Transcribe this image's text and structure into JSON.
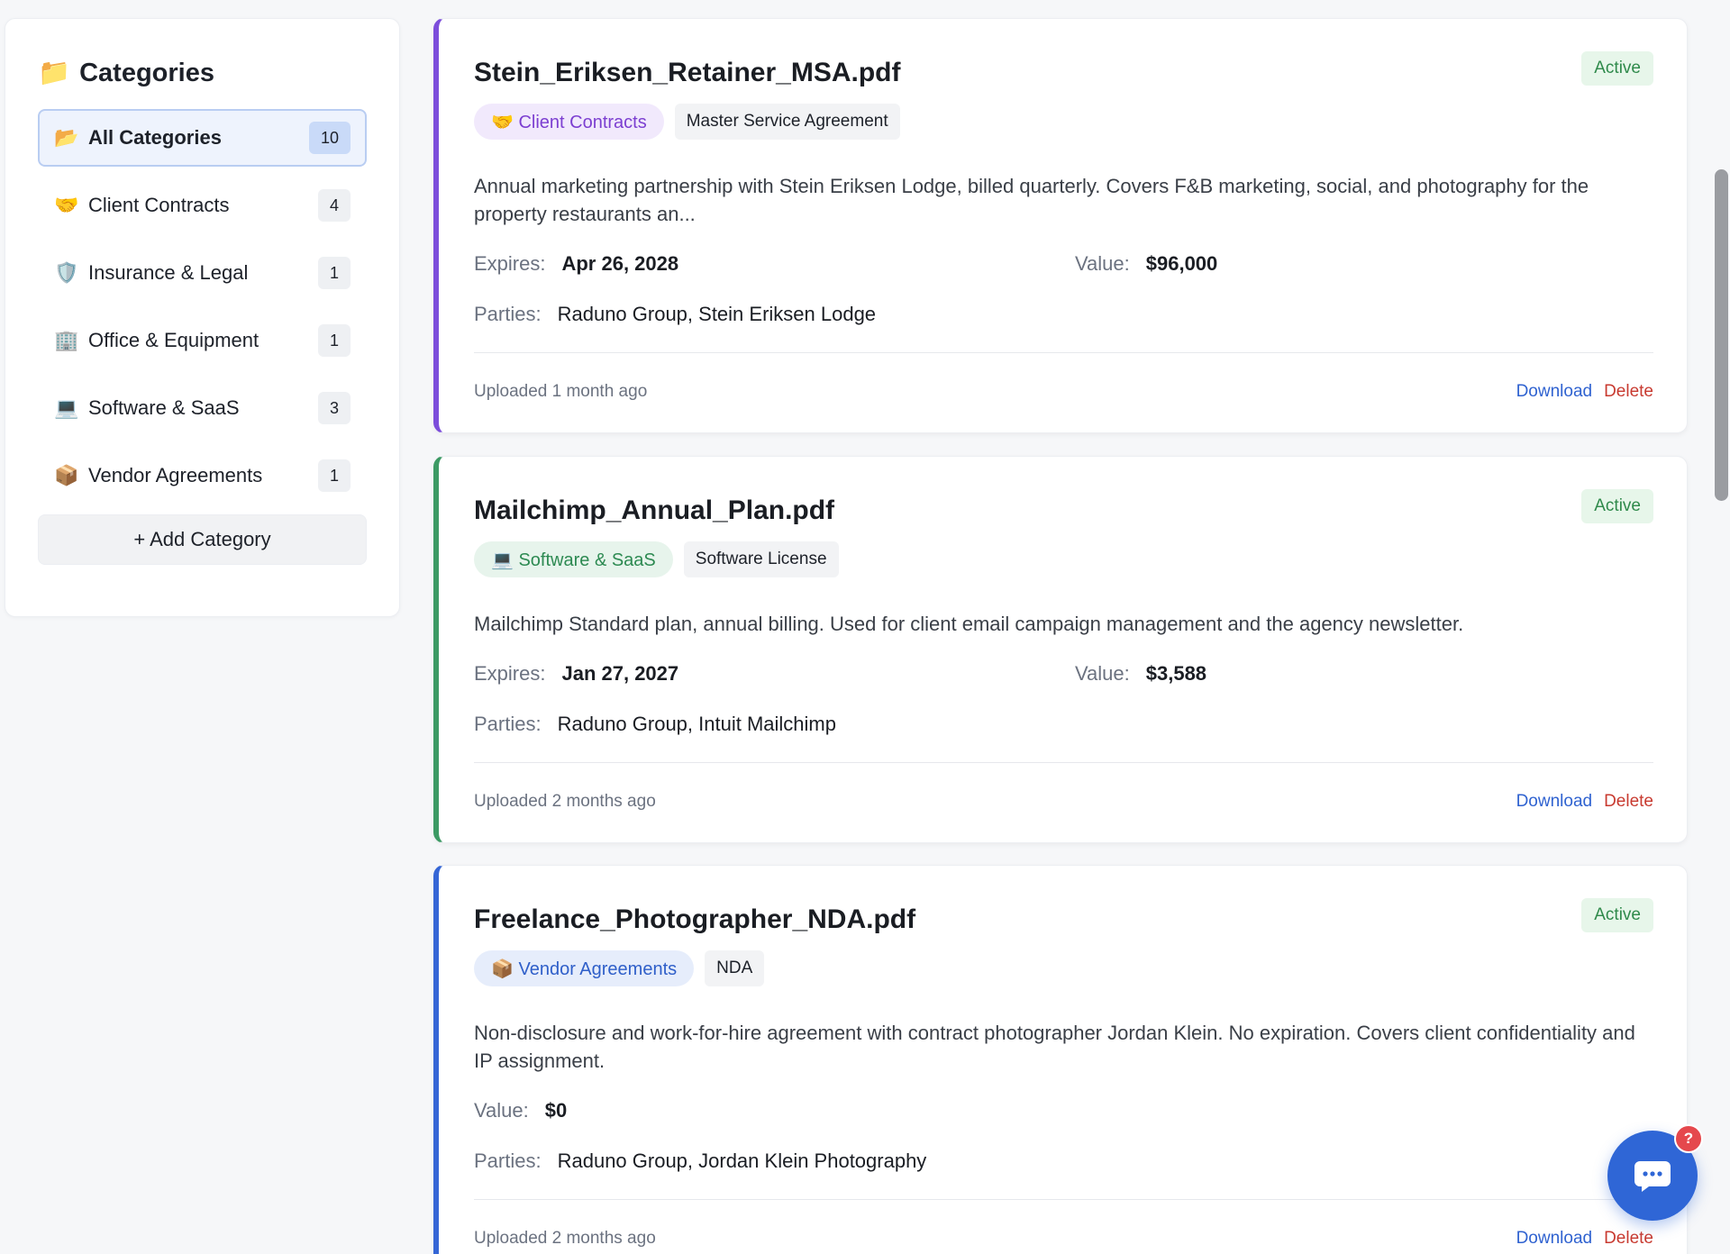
{
  "sidebar": {
    "title_icon": "📁",
    "title": "Categories",
    "items": [
      {
        "emoji": "📂",
        "label": "All Categories",
        "count": "10",
        "active": true
      },
      {
        "emoji": "🤝",
        "label": "Client Contracts",
        "count": "4"
      },
      {
        "emoji": "🛡️",
        "label": "Insurance & Legal",
        "count": "1"
      },
      {
        "emoji": "🏢",
        "label": "Office & Equipment",
        "count": "1"
      },
      {
        "emoji": "💻",
        "label": "Software & SaaS",
        "count": "3"
      },
      {
        "emoji": "📦",
        "label": "Vendor Agreements",
        "count": "1"
      }
    ],
    "add_label": "+ Add Category"
  },
  "cards": [
    {
      "filename": "Stein_Eriksen_Retainer_MSA.pdf",
      "status": "Active",
      "category": "🤝 Client Contracts",
      "type": "Master Service Agreement",
      "description": "Annual marketing partnership with Stein Eriksen Lodge, billed quarterly. Covers F&B marketing, social, and photography for the property restaurants an...",
      "expires_label": "Expires:",
      "expires": "Apr 26, 2028",
      "value_label": "Value:",
      "value": "$96,000",
      "parties_label": "Parties:",
      "parties": "Raduno Group, Stein Eriksen Lodge",
      "uploaded": "Uploaded 1 month ago",
      "download": "Download",
      "delete": "Delete"
    },
    {
      "filename": "Mailchimp_Annual_Plan.pdf",
      "status": "Active",
      "category": "💻 Software & SaaS",
      "type": "Software License",
      "description": "Mailchimp Standard plan, annual billing. Used for client email campaign management and the agency newsletter.",
      "expires_label": "Expires:",
      "expires": "Jan 27, 2027",
      "value_label": "Value:",
      "value": "$3,588",
      "parties_label": "Parties:",
      "parties": "Raduno Group, Intuit Mailchimp",
      "uploaded": "Uploaded 2 months ago",
      "download": "Download",
      "delete": "Delete"
    },
    {
      "filename": "Freelance_Photographer_NDA.pdf",
      "status": "Active",
      "category": "📦 Vendor Agreements",
      "type": "NDA",
      "description": "Non-disclosure and work-for-hire agreement with contract photographer Jordan Klein. No expiration. Covers client confidentiality and IP assignment.",
      "value_label": "Value:",
      "value": "$0",
      "parties_label": "Parties:",
      "parties": "Raduno Group, Jordan Klein Photography",
      "uploaded": "Uploaded 2 months ago",
      "download": "Download",
      "delete": "Delete"
    }
  ],
  "chat": {
    "badge": "?"
  },
  "colors": {
    "client_contracts_accent": "#7c4ddb",
    "software_accent": "#3c9a64",
    "vendor_accent": "#3566d6",
    "active_status": "#2f8a4b",
    "link_blue": "#2f62d0",
    "delete_red": "#c83a30"
  }
}
